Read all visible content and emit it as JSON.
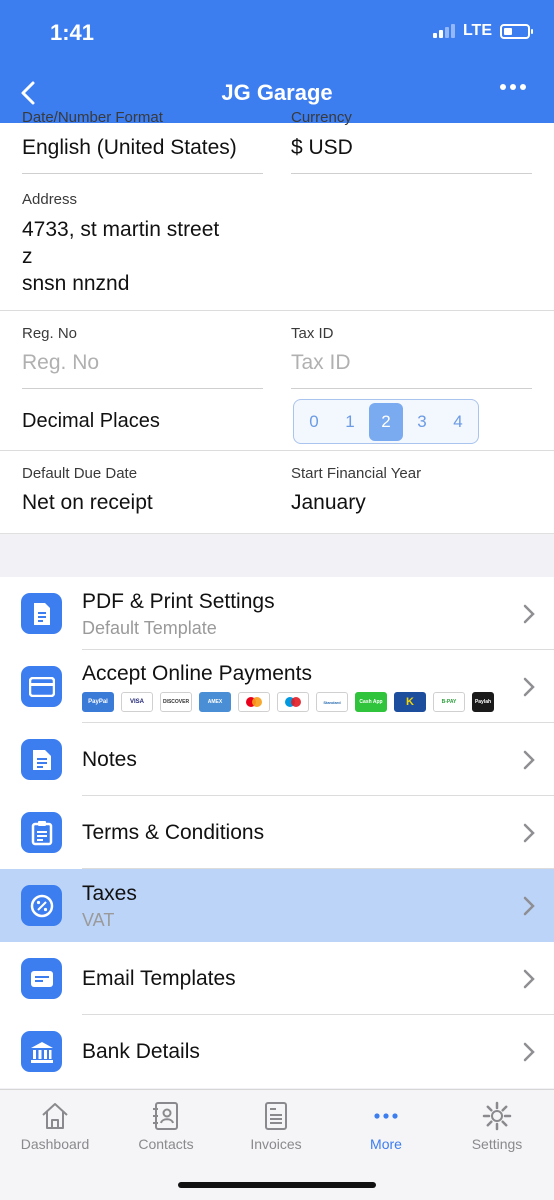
{
  "status": {
    "time": "1:41",
    "network": "LTE"
  },
  "nav": {
    "title": "JG Garage"
  },
  "form": {
    "date_format": {
      "label": "Date/Number Format",
      "value": "English (United States)"
    },
    "currency": {
      "label": "Currency",
      "value": "$ USD"
    },
    "address": {
      "label": "Address",
      "line1": "4733, st martin street",
      "line2": "z",
      "line3": "snsn nnznd"
    },
    "reg_no": {
      "label": "Reg. No",
      "placeholder": "Reg. No"
    },
    "tax_id": {
      "label": "Tax ID",
      "placeholder": "Tax ID"
    },
    "decimal_places": {
      "label": "Decimal Places",
      "options": [
        "0",
        "1",
        "2",
        "3",
        "4"
      ],
      "selected": "2"
    },
    "due_date": {
      "label": "Default Due Date",
      "value": "Net on receipt"
    },
    "financial_year": {
      "label": "Start Financial Year",
      "value": "January"
    }
  },
  "settings_list": [
    {
      "title": "PDF & Print Settings",
      "subtitle": "Default Template",
      "icon": "document-icon"
    },
    {
      "title": "Accept Online Payments",
      "subtitle": "",
      "icon": "card-icon"
    },
    {
      "title": "Notes",
      "subtitle": "",
      "icon": "note-icon"
    },
    {
      "title": "Terms & Conditions",
      "subtitle": "",
      "icon": "clipboard-icon"
    },
    {
      "title": "Taxes",
      "subtitle": "VAT",
      "icon": "percent-icon"
    },
    {
      "title": "Email Templates",
      "subtitle": "",
      "icon": "email-template-icon"
    },
    {
      "title": "Bank Details",
      "subtitle": "",
      "icon": "bank-icon"
    }
  ],
  "payment_logos": {
    "paypal": "PayPal",
    "visa": "VISA",
    "discover": "DISCOVER",
    "amex": "AMEX",
    "mastercard": "",
    "maestro": "",
    "standard": "Standard",
    "cashapp": "Cash App",
    "knet": "K",
    "other": "B-PAY",
    "last": "Paylah"
  },
  "tabs": [
    "Dashboard",
    "Contacts",
    "Invoices",
    "More",
    "Settings"
  ],
  "colors": {
    "brand": "#3c7df0",
    "active_row": "#bcd4f8"
  }
}
